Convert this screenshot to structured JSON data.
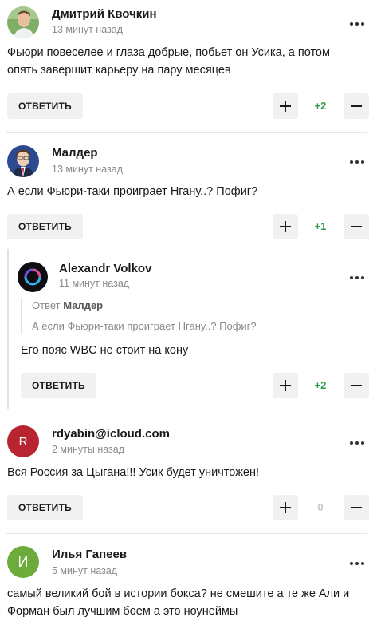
{
  "comments": [
    {
      "author": "Дмитрий Квочкин",
      "time": "13 минут назад",
      "text_lines": [
        "Фьюри повеселее и глаза добрые, побьет он Усика, а потом",
        "опять завершит карьеру на пару месяцев"
      ],
      "reply_label": "ОТВЕТИТЬ",
      "score": "+2"
    },
    {
      "author": "Малдер",
      "time": "13 минут назад",
      "text_lines": [
        "А если Фьюри-таки проиграет Нгану..? Пофиг?"
      ],
      "reply_label": "ОТВЕТИТЬ",
      "score": "+1"
    },
    {
      "author": "Alexandr Volkov",
      "time": "11 минут назад",
      "quote_prefix": "Ответ",
      "quote_author": "Малдер",
      "quote_text": "А если Фьюри-таки проиграет Нгану..? Пофиг?",
      "text_lines": [
        "Его пояс WBC не стоит на кону"
      ],
      "reply_label": "ОТВЕТИТЬ",
      "score": "+2"
    },
    {
      "author": "rdyabin@icloud.com",
      "avatar_letter": "R",
      "time": "2 минуты назад",
      "text_lines": [
        "Вся Россия за Цыгана!!! Усик будет уничтожен!"
      ],
      "reply_label": "ОТВЕТИТЬ",
      "score": "0"
    },
    {
      "author": "Илья Гапеев",
      "avatar_letter": "И",
      "time": "5 минут назад",
      "text_lines": [
        "самый великий бой в истории бокса? не смешите а те же Али и",
        "Форман был лучшим боем а это ноунеймы"
      ]
    }
  ],
  "colors": {
    "positive_score": "#2e9a4a",
    "zero_score": "#c8c8c8",
    "avatar_r": "#b8242f",
    "avatar_i": "#6dac3a"
  }
}
